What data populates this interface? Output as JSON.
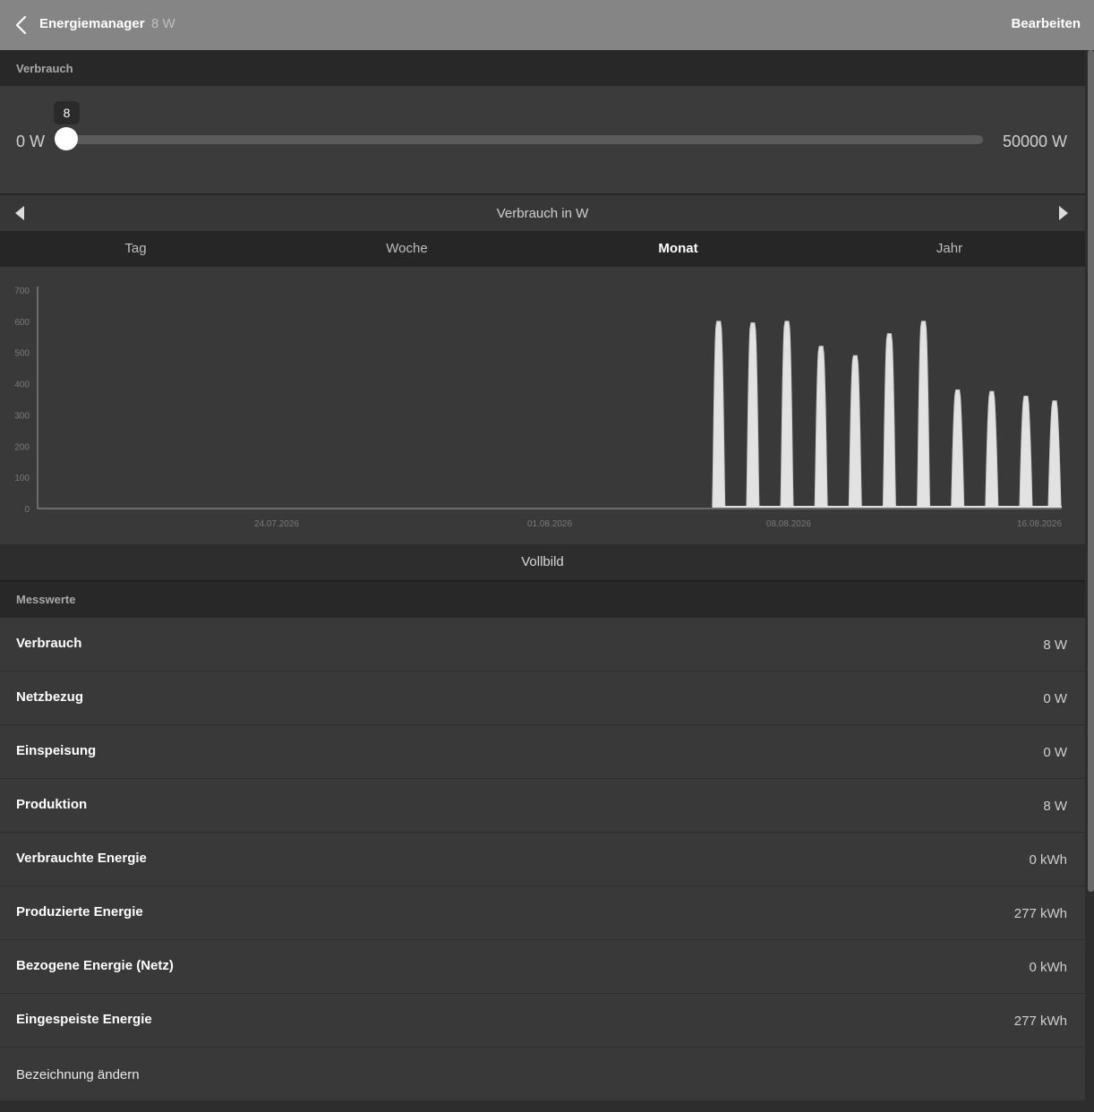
{
  "header": {
    "title": "Energiemanager",
    "subtitle": "8 W",
    "edit_label": "Bearbeiten"
  },
  "consumption_section": {
    "label": "Verbrauch"
  },
  "slider": {
    "min_label": "0 W",
    "max_label": "50000 W",
    "value": 8,
    "tooltip": "8",
    "min": 0,
    "max": 50000
  },
  "chart_nav": {
    "title": "Verbrauch in W"
  },
  "tabs": [
    {
      "label": "Tag",
      "active": false
    },
    {
      "label": "Woche",
      "active": false
    },
    {
      "label": "Monat",
      "active": true
    },
    {
      "label": "Jahr",
      "active": false
    }
  ],
  "fullscreen_label": "Vollbild",
  "measurements_section": {
    "label": "Messwerte"
  },
  "measurements": [
    {
      "label": "Verbrauch",
      "value": "8 W"
    },
    {
      "label": "Netzbezug",
      "value": "0 W"
    },
    {
      "label": "Einspeisung",
      "value": "0 W"
    },
    {
      "label": "Produktion",
      "value": "8 W"
    },
    {
      "label": "Verbrauchte Energie",
      "value": "0 kWh"
    },
    {
      "label": "Produzierte Energie",
      "value": "277 kWh"
    },
    {
      "label": "Bezogene Energie (Netz)",
      "value": "0 kWh"
    },
    {
      "label": "Eingespeiste Energie",
      "value": "277 kWh"
    }
  ],
  "rename_label": "Bezeichnung ändern",
  "chart_data": {
    "type": "area",
    "title": "",
    "xlabel": "",
    "ylabel": "",
    "ylim": [
      0,
      700
    ],
    "yticks": [
      0,
      100,
      200,
      300,
      400,
      500,
      600,
      700
    ],
    "xlim": [
      "2026-07-17",
      "2026-08-16"
    ],
    "xticks": [
      {
        "date": "2026-07-24",
        "label": "24.07.2026"
      },
      {
        "date": "2026-08-01",
        "label": "01.08.2026"
      },
      {
        "date": "2026-08-08",
        "label": "08.08.2026"
      },
      {
        "date": "2026-08-16",
        "label": "16.08.2026"
      }
    ],
    "grid": false,
    "series": [
      {
        "peaks": [
          {
            "date": "2026-08-06",
            "value": 600
          },
          {
            "date": "2026-08-07",
            "value": 595
          },
          {
            "date": "2026-08-08",
            "value": 600
          },
          {
            "date": "2026-08-09",
            "value": 520
          },
          {
            "date": "2026-08-10",
            "value": 490
          },
          {
            "date": "2026-08-11",
            "value": 560
          },
          {
            "date": "2026-08-12",
            "value": 600
          },
          {
            "date": "2026-08-13",
            "value": 380
          },
          {
            "date": "2026-08-14",
            "value": 375
          },
          {
            "date": "2026-08-15",
            "value": 360
          },
          {
            "date": "2026-08-16",
            "value": 345
          }
        ]
      }
    ],
    "colors": {
      "fill": "#e2e2e2",
      "axis": "#8a8a8a",
      "tick_text": "#7a7a7a"
    }
  }
}
